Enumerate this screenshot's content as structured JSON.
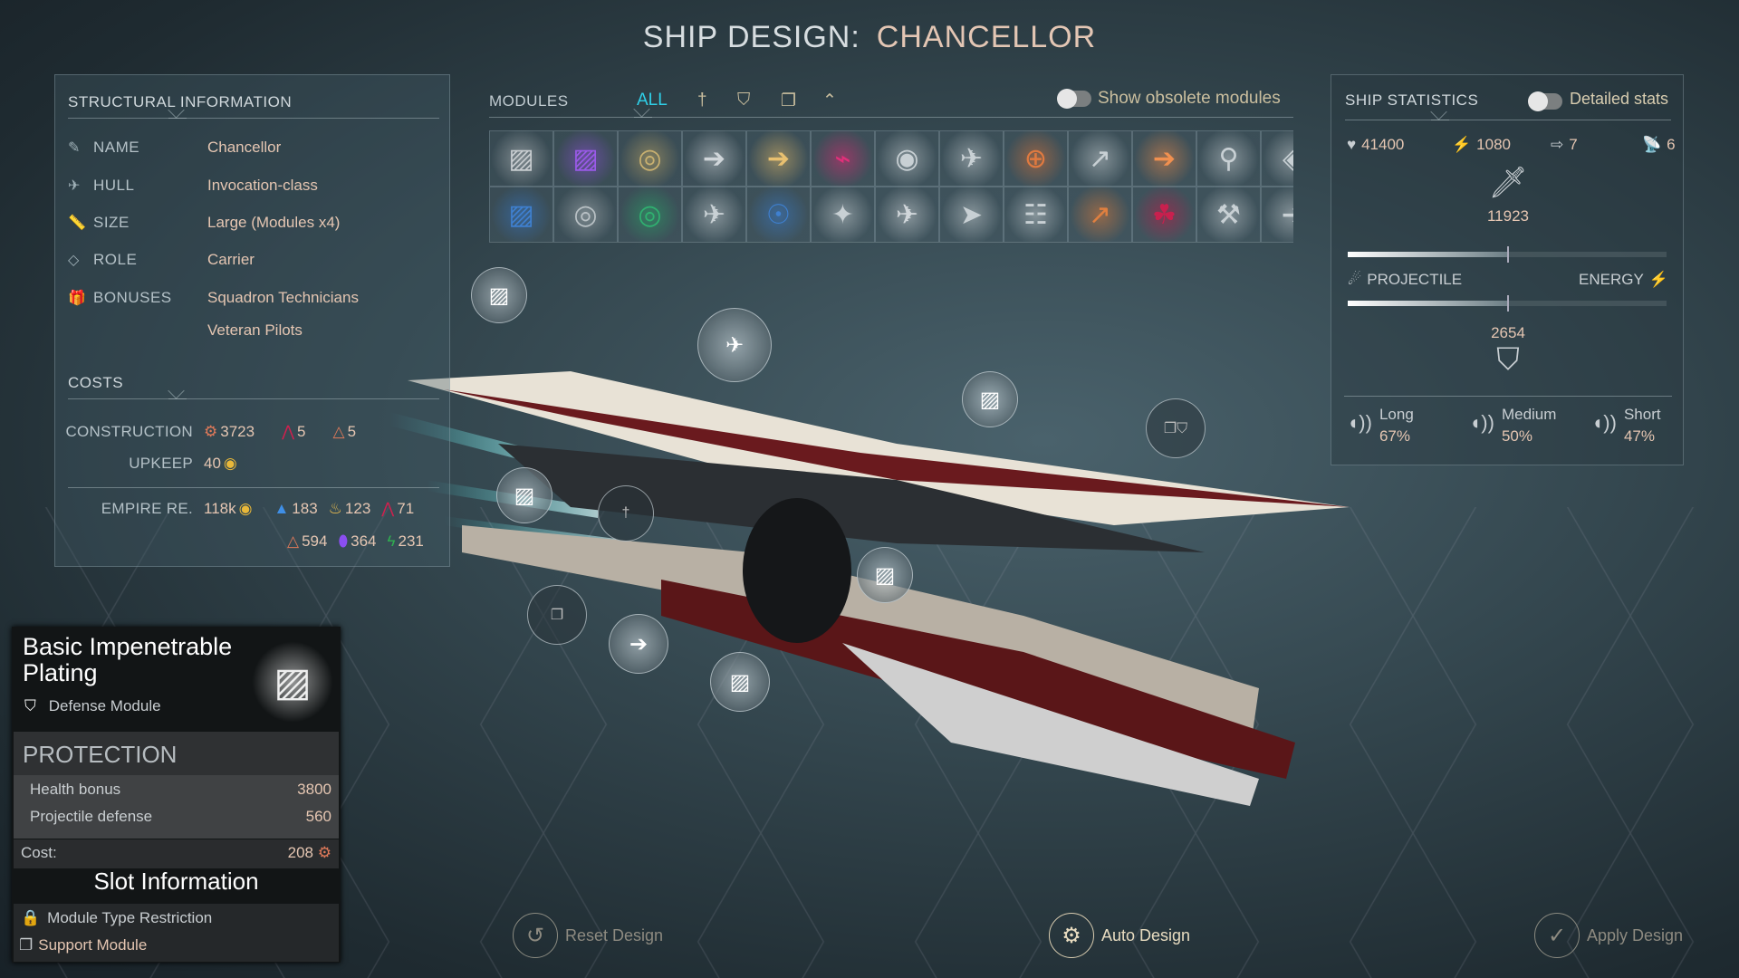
{
  "title": {
    "prefix": "SHIP DESIGN:",
    "name": "CHANCELLOR"
  },
  "structural": {
    "header": "STRUCTURAL INFORMATION",
    "rows": [
      {
        "icon": "pencil-icon",
        "label": "NAME",
        "value": "Chancellor"
      },
      {
        "icon": "ship-icon",
        "label": "HULL",
        "value": "Invocation-class"
      },
      {
        "icon": "ruler-icon",
        "label": "SIZE",
        "value": "Large (Modules x4)"
      },
      {
        "icon": "tag-icon",
        "label": "ROLE",
        "value": "Carrier"
      },
      {
        "icon": "gift-icon",
        "label": "BONUSES",
        "value": "Squadron Technicians"
      }
    ],
    "bonus2": "Veteran Pilots"
  },
  "costs": {
    "header": "COSTS",
    "construction_label": "CONSTRUCTION",
    "construction": [
      {
        "icon": "industry-icon",
        "value": "3723",
        "color": "#e07a5a"
      },
      {
        "icon": "hyperium-icon",
        "value": "5",
        "color": "#d0204e"
      },
      {
        "icon": "titanium-icon",
        "value": "5",
        "color": "#e07a5a"
      }
    ],
    "upkeep_label": "UPKEEP",
    "upkeep": "40",
    "upkeep_color": "#e8b83a",
    "empire_label": "EMPIRE RE.",
    "empire_dust": "118k",
    "empire": [
      {
        "icon": "water-icon",
        "value": "183",
        "color": "#3f8fe6"
      },
      {
        "icon": "fire-icon",
        "value": "123",
        "color": "#f0c050"
      },
      {
        "icon": "hyperium-icon",
        "value": "71",
        "color": "#d0204e"
      },
      {
        "icon": "titanium-icon",
        "value": "594",
        "color": "#e07a5a"
      },
      {
        "icon": "crystal-icon",
        "value": "364",
        "color": "#8a4ef0"
      },
      {
        "icon": "lightning-icon",
        "value": "231",
        "color": "#30b050"
      }
    ]
  },
  "modules": {
    "header": "MODULES",
    "tabs": [
      "ALL",
      "†",
      "⛉",
      "❐",
      "⌃"
    ],
    "active_tab": "ALL",
    "obsolete_label": "Show obsolete modules",
    "obsolete_on": false,
    "items": [
      {
        "g": "▨",
        "c": "#c8cdd0"
      },
      {
        "g": "▨",
        "c": "#9a5ae8"
      },
      {
        "g": "◎",
        "c": "#c8b070"
      },
      {
        "g": "➔",
        "c": "#d0d6da"
      },
      {
        "g": "➔",
        "c": "#e8c070"
      },
      {
        "g": "⌁",
        "c": "#e0307a"
      },
      {
        "g": "◉",
        "c": "#c8d0d4"
      },
      {
        "g": "✈",
        "c": "#c8d0d4"
      },
      {
        "g": "⊕",
        "c": "#e07a40"
      },
      {
        "g": "↗",
        "c": "#c8d0d4"
      },
      {
        "g": "➔",
        "c": "#f09050"
      },
      {
        "g": "⚲",
        "c": "#c8d0d4"
      },
      {
        "g": "◈",
        "c": "#c8d0d4"
      },
      {
        "g": "▨",
        "c": "#3f80d0"
      },
      {
        "g": "◎",
        "c": "#b8c0c4"
      },
      {
        "g": "◎",
        "c": "#30b070"
      },
      {
        "g": "✈",
        "c": "#c8d0d4"
      },
      {
        "g": "☉",
        "c": "#3f80d0"
      },
      {
        "g": "✦",
        "c": "#c8d0d4"
      },
      {
        "g": "✈",
        "c": "#d0d6da"
      },
      {
        "g": "➤",
        "c": "#c8d0d4"
      },
      {
        "g": "☷",
        "c": "#c8d0d4"
      },
      {
        "g": "↗",
        "c": "#e08040"
      },
      {
        "g": "☘",
        "c": "#c8204e"
      },
      {
        "g": "⚒",
        "c": "#c8d0d4"
      },
      {
        "g": "➔",
        "c": "#c8d0d4"
      }
    ]
  },
  "stats": {
    "header": "SHIP STATISTICS",
    "detailed_label": "Detailed stats",
    "detailed_on": false,
    "health": "41400",
    "crew": "1080",
    "speed": "7",
    "detection": "6",
    "attack": "11923",
    "projectile_label": "PROJECTILE",
    "energy_label": "ENERGY",
    "attack_projectile_fraction": 0.5,
    "defense_projectile_fraction": 0.5,
    "defense": "2654",
    "ranges": [
      {
        "label": "Long",
        "value": "67%"
      },
      {
        "label": "Medium",
        "value": "50%"
      },
      {
        "label": "Short",
        "value": "47%"
      }
    ]
  },
  "tooltip": {
    "name": "Basic Impenetrable Plating",
    "type": "Defense Module",
    "section": "PROTECTION",
    "props": [
      {
        "label": "Health bonus",
        "value": "3800"
      },
      {
        "label": "Projectile defense",
        "value": "560"
      }
    ],
    "cost_label": "Cost:",
    "cost": "208",
    "slot_header": "Slot Information",
    "restriction": "Module Type Restriction",
    "slot_type": "Support Module"
  },
  "actions": {
    "reset": "Reset Design",
    "auto": "Auto Design",
    "apply": "Apply Design"
  }
}
